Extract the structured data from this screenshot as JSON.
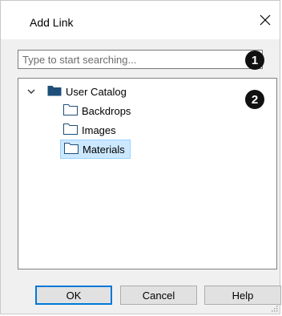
{
  "window": {
    "title": "Add Link"
  },
  "search": {
    "placeholder": "Type to start searching...",
    "value": ""
  },
  "callouts": [
    "1",
    "2"
  ],
  "tree": {
    "root": {
      "label": "User Catalog",
      "expanded": true,
      "icon": "folder-filled-icon",
      "children": [
        {
          "label": "Backdrops",
          "icon": "folder-icon",
          "selected": false
        },
        {
          "label": "Images",
          "icon": "folder-icon",
          "selected": false
        },
        {
          "label": "Materials",
          "icon": "folder-icon",
          "selected": true
        }
      ]
    }
  },
  "buttons": {
    "ok": "OK",
    "cancel": "Cancel",
    "help": "Help"
  },
  "colors": {
    "accent": "#0078d7",
    "selection_bg": "#cce8ff",
    "selection_border": "#99d1ff",
    "root_folder": "#1e4e79",
    "dialog_bg": "#f0f0f0"
  }
}
